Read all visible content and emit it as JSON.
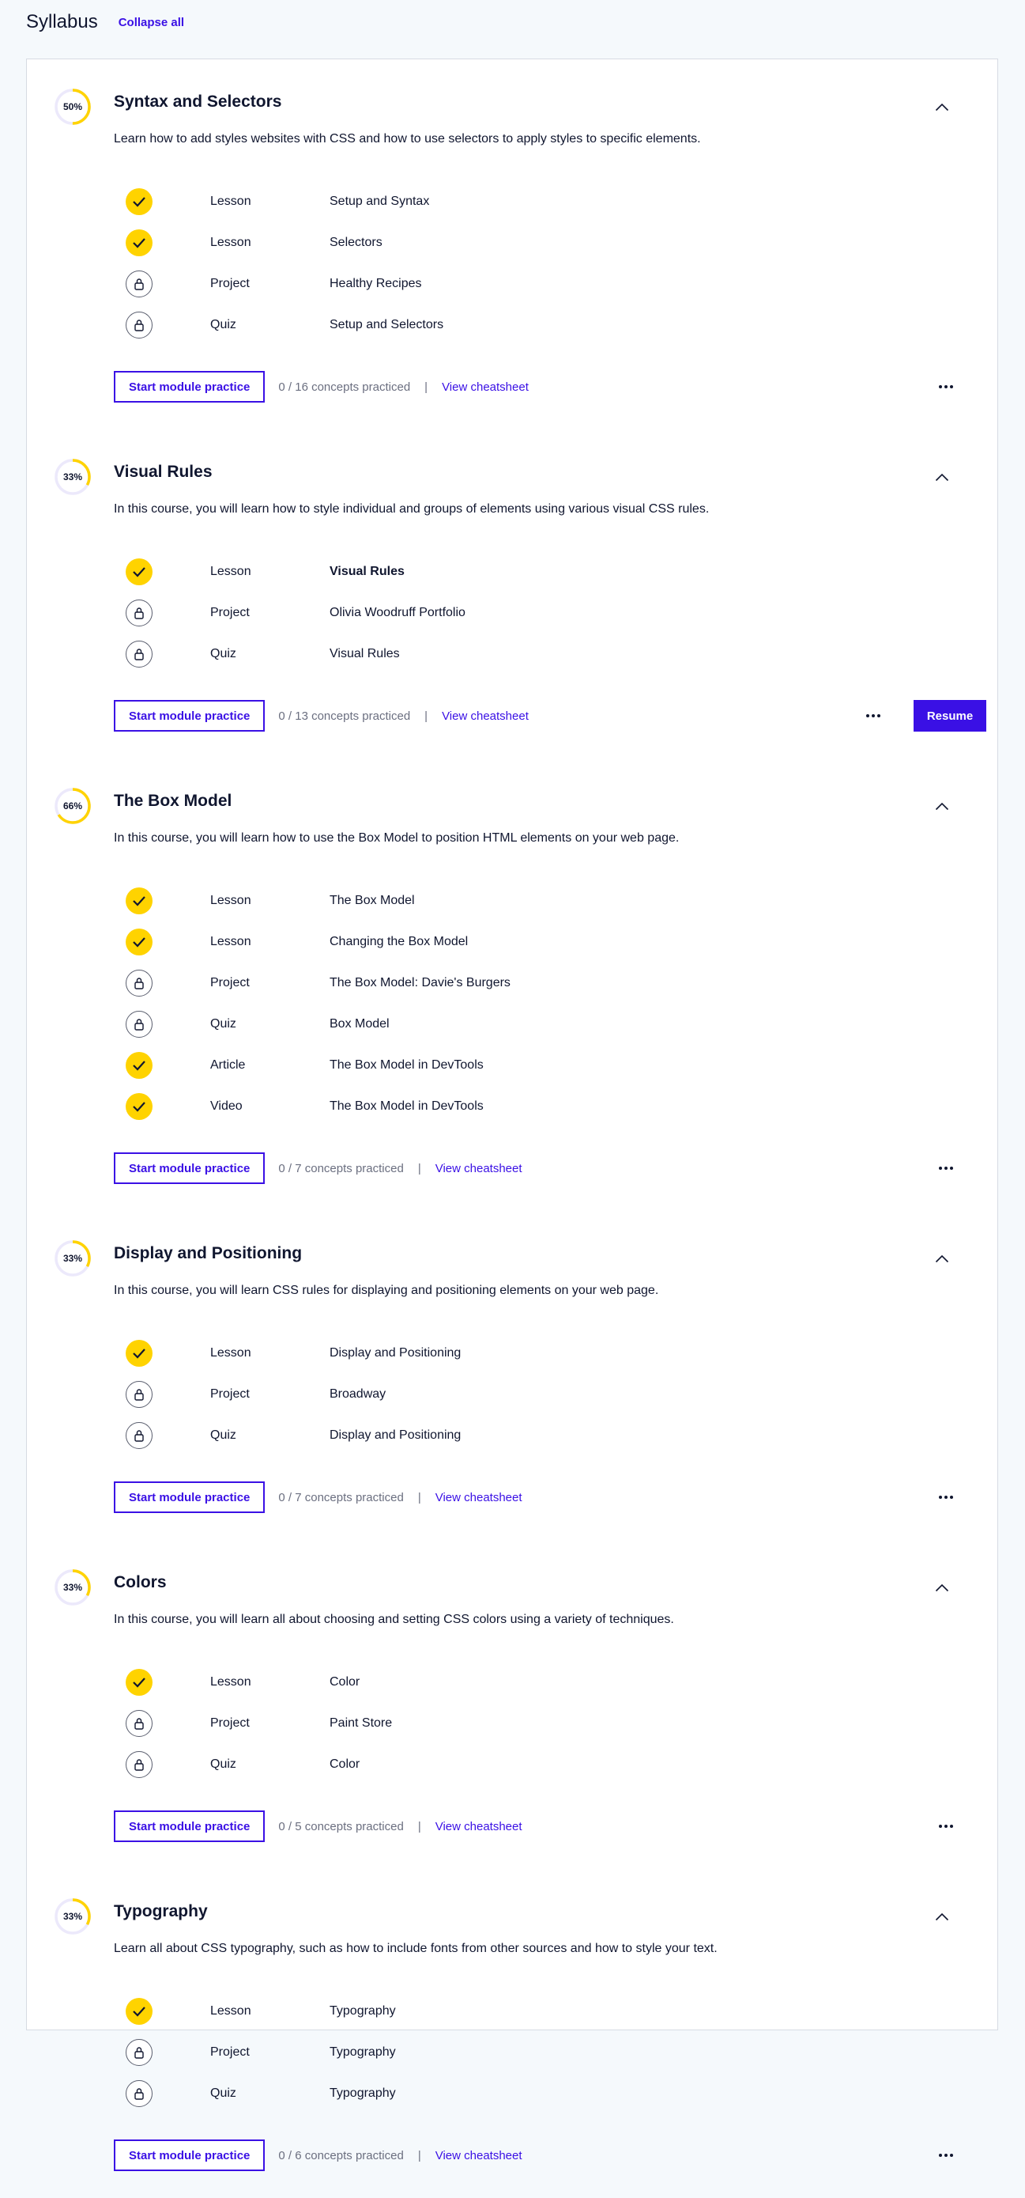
{
  "header": {
    "title": "Syllabus",
    "collapse_label": "Collapse all"
  },
  "colors": {
    "accent": "#3a10e5",
    "done": "#ffd300",
    "ring_track": "#ece9fb"
  },
  "common": {
    "start_practice_label": "Start module practice",
    "cheatsheet_label": "View cheatsheet",
    "separator": "|",
    "resume_label": "Resume"
  },
  "modules": [
    {
      "progress_label": "50%",
      "progress": 0.5,
      "title": "Syntax and Selectors",
      "description": "Learn how to add styles websites with CSS and how to use selectors to apply styles to specific elements.",
      "concepts": "0 / 16 concepts practiced",
      "resume": false,
      "items": [
        {
          "type": "Lesson",
          "name": "Setup and Syntax",
          "status": "done"
        },
        {
          "type": "Lesson",
          "name": "Selectors",
          "status": "done"
        },
        {
          "type": "Project",
          "name": "Healthy Recipes",
          "status": "locked"
        },
        {
          "type": "Quiz",
          "name": "Setup and Selectors",
          "status": "locked"
        }
      ]
    },
    {
      "progress_label": "33%",
      "progress": 0.33,
      "title": "Visual Rules",
      "description": "In this course, you will learn how to style individual and groups of elements using various visual CSS rules.",
      "concepts": "0 / 13 concepts practiced",
      "resume": true,
      "items": [
        {
          "type": "Lesson",
          "name": "Visual Rules",
          "status": "done",
          "current": true
        },
        {
          "type": "Project",
          "name": "Olivia Woodruff Portfolio",
          "status": "locked"
        },
        {
          "type": "Quiz",
          "name": "Visual Rules",
          "status": "locked"
        }
      ]
    },
    {
      "progress_label": "66%",
      "progress": 0.66,
      "title": "The Box Model",
      "description": "In this course, you will learn how to use the Box Model to position HTML elements on your web page.",
      "concepts": "0 / 7 concepts practiced",
      "resume": false,
      "items": [
        {
          "type": "Lesson",
          "name": "The Box Model",
          "status": "done"
        },
        {
          "type": "Lesson",
          "name": "Changing the Box Model",
          "status": "done"
        },
        {
          "type": "Project",
          "name": "The Box Model: Davie's Burgers",
          "status": "locked"
        },
        {
          "type": "Quiz",
          "name": "Box Model",
          "status": "locked"
        },
        {
          "type": "Article",
          "name": "The Box Model in DevTools",
          "status": "done"
        },
        {
          "type": "Video",
          "name": "The Box Model in DevTools",
          "status": "done"
        }
      ]
    },
    {
      "progress_label": "33%",
      "progress": 0.33,
      "title": "Display and Positioning",
      "description": "In this course, you will learn CSS rules for displaying and positioning elements on your web page.",
      "concepts": "0 / 7 concepts practiced",
      "resume": false,
      "items": [
        {
          "type": "Lesson",
          "name": "Display and Positioning",
          "status": "done"
        },
        {
          "type": "Project",
          "name": "Broadway",
          "status": "locked"
        },
        {
          "type": "Quiz",
          "name": "Display and Positioning",
          "status": "locked"
        }
      ]
    },
    {
      "progress_label": "33%",
      "progress": 0.33,
      "title": "Colors",
      "description": "In this course, you will learn all about choosing and setting CSS colors using a variety of techniques.",
      "concepts": "0 / 5 concepts practiced",
      "resume": false,
      "items": [
        {
          "type": "Lesson",
          "name": "Color",
          "status": "done"
        },
        {
          "type": "Project",
          "name": "Paint Store",
          "status": "locked"
        },
        {
          "type": "Quiz",
          "name": "Color",
          "status": "locked"
        }
      ]
    },
    {
      "progress_label": "33%",
      "progress": 0.33,
      "title": "Typography",
      "description": "Learn all about CSS typography, such as how to include fonts from other sources and how to style your text.",
      "concepts": "0 / 6 concepts practiced",
      "resume": false,
      "items": [
        {
          "type": "Lesson",
          "name": "Typography",
          "status": "done"
        },
        {
          "type": "Project",
          "name": "Typography",
          "status": "locked"
        },
        {
          "type": "Quiz",
          "name": "Typography",
          "status": "locked"
        }
      ]
    }
  ]
}
